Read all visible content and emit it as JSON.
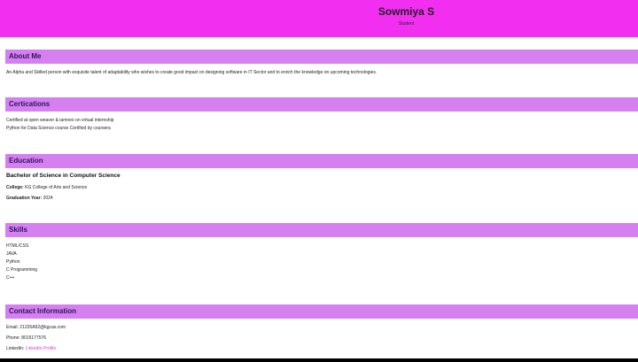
{
  "header": {
    "name": "Sowmiya S",
    "role": "Student"
  },
  "about": {
    "title": "About Me",
    "text": "An Alpha and Skilled person with exquisite talent of adaptability who wishes to create good impact on designing software in IT Sector and to enrich the knowledge on upcoming technologies."
  },
  "certifications": {
    "title": "Certications",
    "items": [
      "Certified at open weaver & iamneo on virtual internship",
      "Python for Data Science course Certified by coursera"
    ]
  },
  "education": {
    "title": "Education",
    "degree": "Bachelor of Science in Computer Science",
    "college_label": "College:",
    "college": "KG College of Arts and Science",
    "year_label": "Graduation Year:",
    "year": "2024"
  },
  "skills": {
    "title": "Skills",
    "items": [
      "HTML/CSS",
      "JAVA",
      "Python",
      "C Programming",
      "C++"
    ]
  },
  "contact": {
    "title": "Contact Information",
    "email_label": "Email:",
    "email": "21226A92@kgcas.com",
    "phone_label": "Phone:",
    "phone": "8015177576",
    "linkedin_label": "LinkedIn:",
    "linkedin_text": "LinkedIn Profile"
  },
  "colors": {
    "header_bg": "#f22ff0",
    "section_bar": "#d67ff0",
    "section_title": "#2a1560",
    "link": "#e23ad8"
  }
}
